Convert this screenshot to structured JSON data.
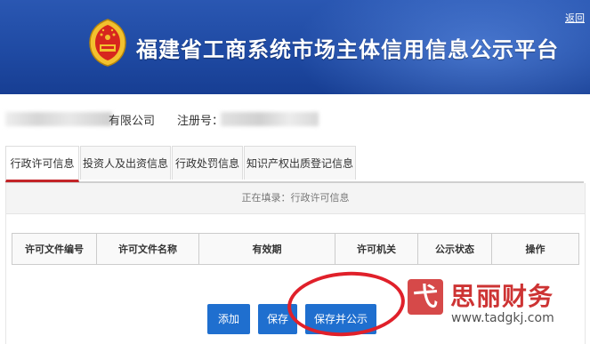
{
  "header": {
    "title": "福建省工商系统市场主体信用信息公示平台",
    "back_label": "返回"
  },
  "company": {
    "name_suffix": "有限公司",
    "reg_label": "注册号："
  },
  "tabs": [
    {
      "label": "行政许可信息",
      "active": true
    },
    {
      "label": "投资人及出资信息",
      "active": false
    },
    {
      "label": "行政处罚信息",
      "active": false
    },
    {
      "label": "知识产权出质登记信息",
      "active": false
    }
  ],
  "status_text": "正在填录：行政许可信息",
  "table": {
    "columns": [
      "许可文件编号",
      "许可文件名称",
      "有效期",
      "许可机关",
      "公示状态",
      "操作"
    ]
  },
  "buttons": {
    "add": "添加",
    "save": "保存",
    "save_publish": "保存并公示"
  },
  "watermark": {
    "logo_char": "弋",
    "name": "思丽财务",
    "url": "www.tadgkj.com"
  },
  "colors": {
    "banner_blue": "#1f4aa3",
    "button_blue": "#1f6fcf",
    "tab_active_red": "#c32428",
    "annotation_red": "#e0202a"
  }
}
